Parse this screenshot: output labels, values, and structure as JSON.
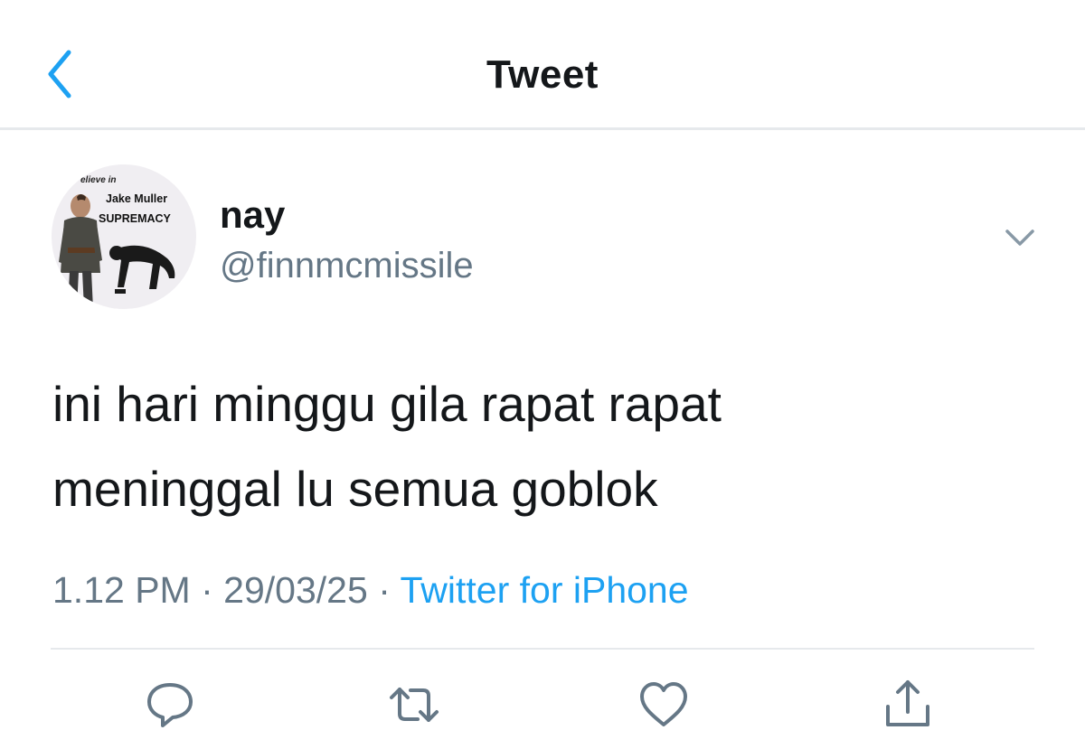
{
  "header": {
    "title": "Tweet",
    "back_icon": "chevron-left-icon"
  },
  "author": {
    "display_name": "nay",
    "handle": "@finnmcmissile",
    "avatar": {
      "text_top": "elieve in",
      "text_name": "Jake Muller",
      "text_main": "SUPREMACY"
    }
  },
  "tweet": {
    "lines": [
      "ini hari minggu gila rapat rapat",
      "meninggal lu semua goblok"
    ],
    "time": "1.12 PM",
    "date": "29/03/25",
    "separator": "·",
    "source": "Twitter for iPhone"
  },
  "actions": {
    "icons": [
      "reply-icon",
      "retweet-icon",
      "like-icon",
      "share-icon"
    ]
  },
  "colors": {
    "accent": "#1da1f2",
    "text": "#14171a",
    "secondary_text": "#657786",
    "divider": "#e6e9ec"
  }
}
